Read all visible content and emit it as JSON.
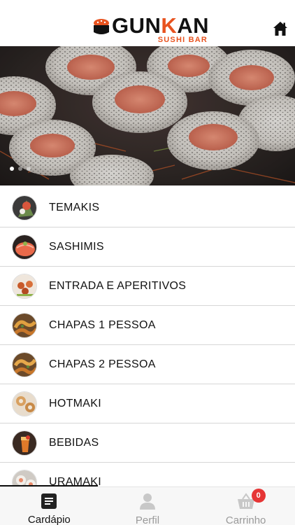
{
  "header": {
    "logo_main_prefix": "GUN",
    "logo_main_k": "K",
    "logo_main_suffix": "AN",
    "logo_sub": "SUSHI BAR",
    "home_icon": "home-icon"
  },
  "banner": {
    "slides_total": 3,
    "active_slide": 1
  },
  "categories": [
    {
      "label": "TEMAKIS",
      "thumb_color": "#9a4a3a"
    },
    {
      "label": "SASHIMIS",
      "thumb_color": "#c85a3c"
    },
    {
      "label": "ENTRADA E APERITIVOS",
      "thumb_color": "#b86a3a"
    },
    {
      "label": "CHAPAS 1 PESSOA",
      "thumb_color": "#c8883a"
    },
    {
      "label": "CHAPAS 2 PESSOA",
      "thumb_color": "#c48a3c"
    },
    {
      "label": "HOTMAKI",
      "thumb_color": "#c8965a"
    },
    {
      "label": "BEBIDAS",
      "thumb_color": "#c86a2a"
    },
    {
      "label": "URAMAKI",
      "thumb_color": "#cfcac4"
    }
  ],
  "bottom_nav": {
    "tabs": [
      {
        "label": "Cardápio",
        "icon": "menu-list-icon",
        "active": true
      },
      {
        "label": "Perfil",
        "icon": "user-icon",
        "active": false
      },
      {
        "label": "Carrinho",
        "icon": "basket-icon",
        "active": false
      }
    ],
    "cart_count": "0"
  },
  "colors": {
    "brand_orange": "#e8531f",
    "badge_red": "#e63535",
    "inactive_gray": "#9a9a9a"
  }
}
